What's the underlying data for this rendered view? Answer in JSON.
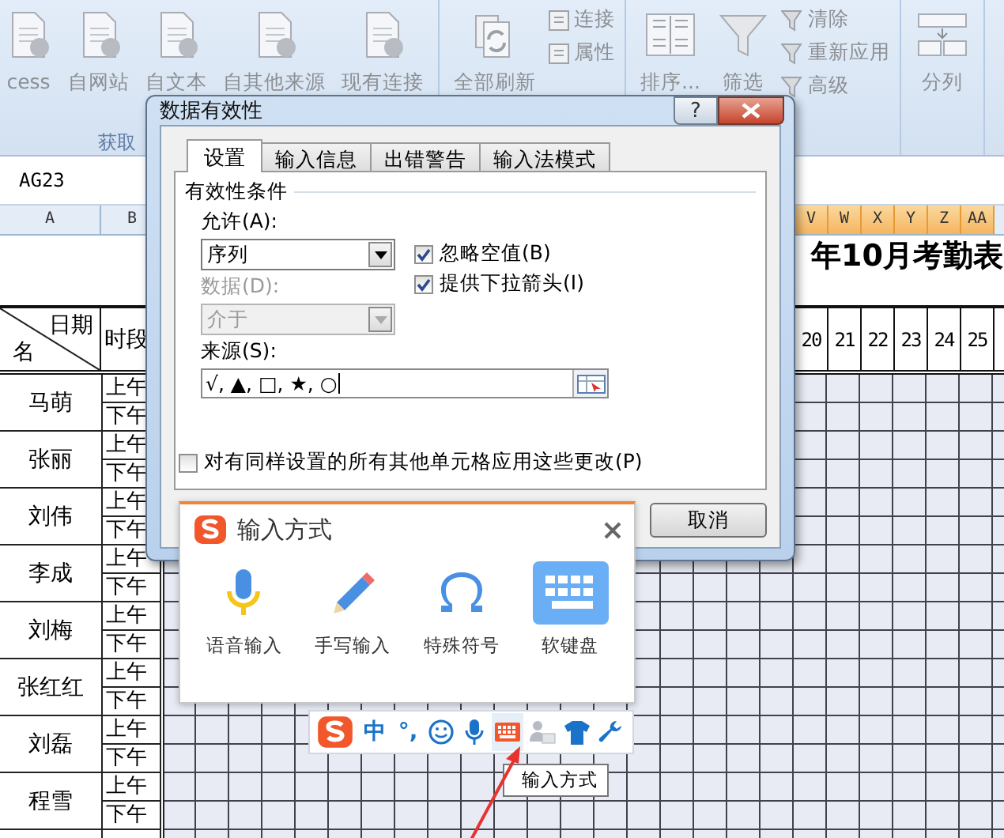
{
  "ribbon": {
    "groups": [
      {
        "label": "获取",
        "large": [
          {
            "label": "cess",
            "kind": "doc"
          },
          {
            "label": "自网站",
            "kind": "doc"
          },
          {
            "label": "自文本",
            "kind": "doc"
          },
          {
            "label": "自其他来源",
            "kind": "doc"
          },
          {
            "label": "现有连接",
            "kind": "doc"
          }
        ]
      },
      {
        "large": [
          {
            "label": "全部刷新",
            "kind": "refresh"
          }
        ],
        "small": [
          {
            "label": "连接"
          },
          {
            "label": "属性"
          }
        ]
      },
      {
        "large": [
          {
            "label": "排序...",
            "kind": "sort"
          },
          {
            "label": "筛选",
            "kind": "filter"
          }
        ],
        "small": [
          {
            "label": "清除"
          },
          {
            "label": "重新应用"
          },
          {
            "label": "高级"
          }
        ]
      },
      {
        "large": [
          {
            "label": "分列",
            "kind": "split"
          }
        ]
      }
    ]
  },
  "name_box": "AG23",
  "column_headers": [
    {
      "label": "A",
      "selected": false
    },
    {
      "label": "B",
      "selected": false
    },
    {
      "label": "V",
      "selected": true
    },
    {
      "label": "W",
      "selected": true
    },
    {
      "label": "X",
      "selected": true
    },
    {
      "label": "Y",
      "selected": true
    },
    {
      "label": "Z",
      "selected": true
    },
    {
      "label": "AA",
      "selected": true
    }
  ],
  "sheet": {
    "title": "年10月考勤表",
    "corner_top": "日期",
    "corner_bottom": "名",
    "period_header": "时段",
    "days": [
      "20",
      "21",
      "22",
      "23",
      "24",
      "25"
    ],
    "rows": [
      {
        "name": "马萌",
        "periods": [
          "上午",
          "下午"
        ]
      },
      {
        "name": "张丽",
        "periods": [
          "上午",
          "下午"
        ]
      },
      {
        "name": "刘伟",
        "periods": [
          "上午",
          "下午"
        ]
      },
      {
        "name": "李成",
        "periods": [
          "上午",
          "下午"
        ]
      },
      {
        "name": "刘梅",
        "periods": [
          "上午",
          "下午"
        ]
      },
      {
        "name": "张红红",
        "periods": [
          "上午",
          "下午"
        ]
      },
      {
        "name": "刘磊",
        "periods": [
          "上午",
          "下午"
        ]
      },
      {
        "name": "程雪",
        "periods": [
          "上午",
          "下午"
        ]
      }
    ]
  },
  "dialog": {
    "title": "数据有效性",
    "help": "?",
    "tabs": [
      {
        "label": "设置",
        "selected": true
      },
      {
        "label": "输入信息",
        "selected": false
      },
      {
        "label": "出错警告",
        "selected": false
      },
      {
        "label": "输入法模式",
        "selected": false
      }
    ],
    "group_label": "有效性条件",
    "allow_label": "允许(A):",
    "allow_value": "序列",
    "checkboxes": [
      {
        "label": "忽略空值(B)",
        "checked": true
      },
      {
        "label": "提供下拉箭头(I)",
        "checked": true
      }
    ],
    "data_label": "数据(D):",
    "data_value": "介于",
    "data_disabled": true,
    "source_label": "来源(S):",
    "source_value": "√, ▲, □, ★, ○",
    "apply_all": {
      "label": "对有同样设置的所有其他单元格应用这些更改(P)",
      "checked": false
    },
    "cancel": "取消"
  },
  "ime_popup": {
    "title": "输入方式",
    "items": [
      {
        "label": "语音输入",
        "kind": "voice",
        "selected": false
      },
      {
        "label": "手写输入",
        "kind": "handwrite",
        "selected": false
      },
      {
        "label": "特殊符号",
        "kind": "symbol",
        "selected": false
      },
      {
        "label": "软键盘",
        "kind": "keyboard",
        "selected": true
      }
    ]
  },
  "ime_toolbar": {
    "items": [
      {
        "kind": "logo",
        "selected": false
      },
      {
        "kind": "text",
        "label": "中",
        "selected": false
      },
      {
        "kind": "text",
        "label": "°,",
        "selected": false
      },
      {
        "kind": "smiley",
        "selected": false
      },
      {
        "kind": "voice",
        "selected": false
      },
      {
        "kind": "keyboard",
        "selected": true
      },
      {
        "kind": "person",
        "selected": false
      },
      {
        "kind": "shirt",
        "selected": false
      },
      {
        "kind": "wrench",
        "selected": false
      }
    ]
  },
  "tooltip": "输入方式"
}
